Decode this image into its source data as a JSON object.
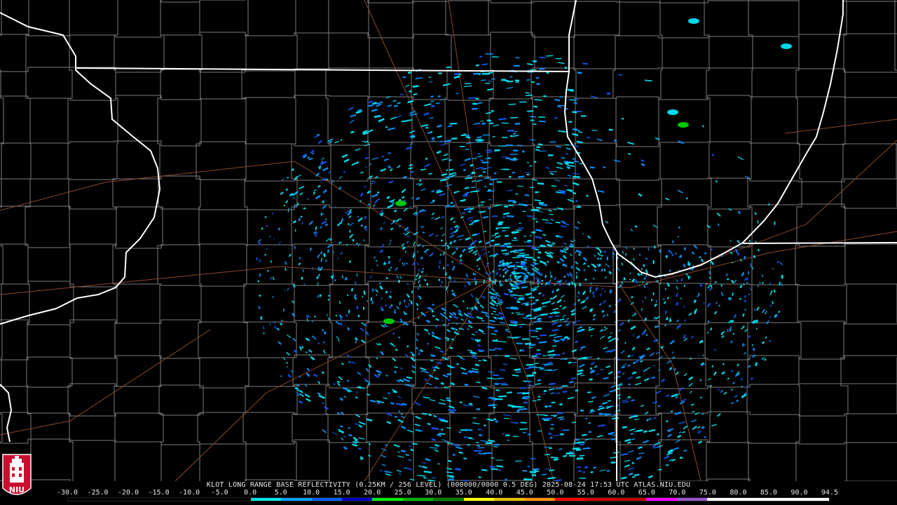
{
  "product_title": "KLOT LONG RANGE BASE REFLECTIVITY (0.25KM / 256 LEVEL) (000000/0000 0.5 DEG) 2025-08-24 17:53 UTC  ATLAS.NIU.EDU",
  "logo_text": "NIU",
  "scale": {
    "labels": [
      "-30.0",
      "-25.0",
      "-20.0",
      "-15.0",
      "-10.0",
      "-5.0",
      "0.0",
      "5.0",
      "10.0",
      "15.0",
      "20.0",
      "25.0",
      "30.0",
      "35.0",
      "40.0",
      "45.0",
      "50.0",
      "55.0",
      "60.0",
      "65.0",
      "70.0",
      "75.0",
      "80.0",
      "85.0",
      "90.0",
      "94.5"
    ],
    "colors": [
      "#000000",
      "#000000",
      "#000000",
      "#000000",
      "#000000",
      "#000000",
      "#00e3e3",
      "#00a2f2",
      "#0060f0",
      "#0000c8",
      "#00f000",
      "#00b800",
      "#008000",
      "#ffff00",
      "#e7c000",
      "#ff9000",
      "#ff0000",
      "#d60000",
      "#c00000",
      "#ff00ff",
      "#9955c9",
      "#ffffff",
      "#ffffff",
      "#ffffff",
      "#ffffff"
    ]
  },
  "colors": {
    "background": "#000000",
    "state_border": "#ffffff",
    "county_border": "#7d7d7d",
    "highway": "#8b4a2b",
    "echo_light": "#00d8e8",
    "echo_medium": "#0a8cf0",
    "echo_strong": "#1050e0",
    "echo_green": "#00c800"
  },
  "icons": {
    "logo": "niu-tower-logo"
  }
}
